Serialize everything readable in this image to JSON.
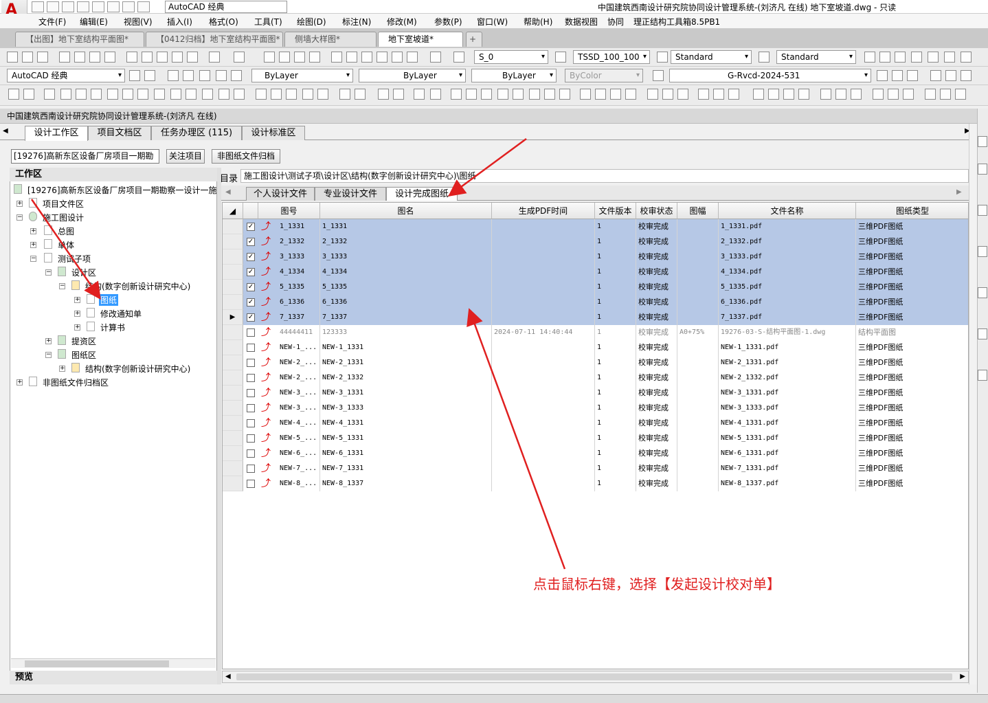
{
  "window": {
    "workspace": "AutoCAD 经典",
    "title": "中国建筑西南设计研究院协同设计管理系统-(刘济凡 在线)    地下室坡道.dwg - 只读"
  },
  "menu": [
    "文件(F)",
    "编辑(E)",
    "视图(V)",
    "插入(I)",
    "格式(O)",
    "工具(T)",
    "绘图(D)",
    "标注(N)",
    "修改(M)",
    "参数(P)",
    "窗口(W)",
    "帮助(H)",
    "数据视图",
    "协同",
    "理正结构工具箱8.5PB1"
  ],
  "doc_tabs": [
    {
      "label": "【出图】地下室结构平面图*",
      "active": false
    },
    {
      "label": "【0412归档】地下室结构平面图*",
      "active": false
    },
    {
      "label": "侧墙大样图*",
      "active": false
    },
    {
      "label": "地下室坡道*",
      "active": true
    }
  ],
  "toolbar": {
    "textstyle": "S_0",
    "dimstyle": "TSSD_100_100",
    "tablestyle": "Standard",
    "mlstyle": "Standard",
    "workspace2": "AutoCAD 经典",
    "color": "ByLayer",
    "linetype": "ByLayer",
    "lineweight": "ByLayer",
    "plotstyle": "ByColor",
    "layer": "G-Rvcd-2024-531"
  },
  "panel": {
    "title": "中国建筑西南设计研究院协同设计管理系统-(刘济凡 在线)",
    "tabs": [
      {
        "label": "设计工作区",
        "active": true
      },
      {
        "label": "项目文档区",
        "active": false
      },
      {
        "label": "任务办理区 (115)",
        "active": false
      },
      {
        "label": "设计标准区",
        "active": false
      }
    ],
    "project_select": "[19276]高新东区设备厂房项目一期勘",
    "follow_btn": "关注项目",
    "nonfile_btn": "非图纸文件归档"
  },
  "tree": {
    "header": "工作区",
    "preview": "预览",
    "root": "[19276]高新东区设备厂房项目一期勘察一设计一施",
    "items": {
      "proj_files": "项目文件区",
      "construction": "施工图设计",
      "general": "总图",
      "single": "单体",
      "test": "测试子项",
      "design": "设计区",
      "structure": "结构(数字创新设计研究中心)",
      "drawings": "图纸",
      "notice": "修改通知单",
      "calc": "计算书",
      "submit": "提资区",
      "drawzone": "图纸区",
      "structure2": "结构(数字创新设计研究中心)",
      "nonfile": "非图纸文件归档区"
    }
  },
  "content": {
    "dir_label": "目录",
    "dir_path": "施工图设计\\测试子项\\设计区\\结构(数字创新设计研究中心)\\图纸",
    "subtabs": [
      {
        "label": "个人设计文件",
        "active": false
      },
      {
        "label": "专业设计文件",
        "active": false
      },
      {
        "label": "设计完成图纸",
        "active": true
      }
    ],
    "columns": [
      "图号",
      "图名",
      "生成PDF时间",
      "文件版本",
      "校审状态",
      "图幅",
      "文件名称",
      "图纸类型"
    ],
    "rows": [
      {
        "no": "1_1331",
        "name": "1_1331",
        "time": "",
        "ver": "1",
        "status": "校审完成",
        "size": "",
        "file": "1_1331.pdf",
        "type": "三维PDF图纸",
        "checked": true,
        "selected": true
      },
      {
        "no": "2_1332",
        "name": "2_1332",
        "time": "",
        "ver": "1",
        "status": "校审完成",
        "size": "",
        "file": "2_1332.pdf",
        "type": "三维PDF图纸",
        "checked": true,
        "selected": true
      },
      {
        "no": "3_1333",
        "name": "3_1333",
        "time": "",
        "ver": "1",
        "status": "校审完成",
        "size": "",
        "file": "3_1333.pdf",
        "type": "三维PDF图纸",
        "checked": true,
        "selected": true
      },
      {
        "no": "4_1334",
        "name": "4_1334",
        "time": "",
        "ver": "1",
        "status": "校审完成",
        "size": "",
        "file": "4_1334.pdf",
        "type": "三维PDF图纸",
        "checked": true,
        "selected": true
      },
      {
        "no": "5_1335",
        "name": "5_1335",
        "time": "",
        "ver": "1",
        "status": "校审完成",
        "size": "",
        "file": "5_1335.pdf",
        "type": "三维PDF图纸",
        "checked": true,
        "selected": true
      },
      {
        "no": "6_1336",
        "name": "6_1336",
        "time": "",
        "ver": "1",
        "status": "校审完成",
        "size": "",
        "file": "6_1336.pdf",
        "type": "三维PDF图纸",
        "checked": true,
        "selected": true
      },
      {
        "no": "7_1337",
        "name": "7_1337",
        "time": "",
        "ver": "1",
        "status": "校审完成",
        "size": "",
        "file": "7_1337.pdf",
        "type": "三维PDF图纸",
        "checked": true,
        "selected": true,
        "current": true
      },
      {
        "no": "44444411",
        "name": "123333",
        "time": "2024-07-11 14:40:44",
        "ver": "1",
        "status": "校审完成",
        "size": "A0+75%",
        "file": "19276-03-S-结构平面图-1.dwg",
        "type": "结构平面图",
        "checked": false,
        "selected": false,
        "gray": true
      },
      {
        "no": "NEW-1_...",
        "name": "NEW-1_1331",
        "time": "",
        "ver": "1",
        "status": "校审完成",
        "size": "",
        "file": "NEW-1_1331.pdf",
        "type": "三维PDF图纸",
        "checked": false,
        "selected": false
      },
      {
        "no": "NEW-2_...",
        "name": "NEW-2_1331",
        "time": "",
        "ver": "1",
        "status": "校审完成",
        "size": "",
        "file": "NEW-2_1331.pdf",
        "type": "三维PDF图纸",
        "checked": false,
        "selected": false
      },
      {
        "no": "NEW-2_...",
        "name": "NEW-2_1332",
        "time": "",
        "ver": "1",
        "status": "校审完成",
        "size": "",
        "file": "NEW-2_1332.pdf",
        "type": "三维PDF图纸",
        "checked": false,
        "selected": false
      },
      {
        "no": "NEW-3_...",
        "name": "NEW-3_1331",
        "time": "",
        "ver": "1",
        "status": "校审完成",
        "size": "",
        "file": "NEW-3_1331.pdf",
        "type": "三维PDF图纸",
        "checked": false,
        "selected": false
      },
      {
        "no": "NEW-3_...",
        "name": "NEW-3_1333",
        "time": "",
        "ver": "1",
        "status": "校审完成",
        "size": "",
        "file": "NEW-3_1333.pdf",
        "type": "三维PDF图纸",
        "checked": false,
        "selected": false
      },
      {
        "no": "NEW-4_...",
        "name": "NEW-4_1331",
        "time": "",
        "ver": "1",
        "status": "校审完成",
        "size": "",
        "file": "NEW-4_1331.pdf",
        "type": "三维PDF图纸",
        "checked": false,
        "selected": false
      },
      {
        "no": "NEW-5_...",
        "name": "NEW-5_1331",
        "time": "",
        "ver": "1",
        "status": "校审完成",
        "size": "",
        "file": "NEW-5_1331.pdf",
        "type": "三维PDF图纸",
        "checked": false,
        "selected": false
      },
      {
        "no": "NEW-6_...",
        "name": "NEW-6_1331",
        "time": "",
        "ver": "1",
        "status": "校审完成",
        "size": "",
        "file": "NEW-6_1331.pdf",
        "type": "三维PDF图纸",
        "checked": false,
        "selected": false
      },
      {
        "no": "NEW-7_...",
        "name": "NEW-7_1331",
        "time": "",
        "ver": "1",
        "status": "校审完成",
        "size": "",
        "file": "NEW-7_1331.pdf",
        "type": "三维PDF图纸",
        "checked": false,
        "selected": false
      },
      {
        "no": "NEW-8_...",
        "name": "NEW-8_1337",
        "time": "",
        "ver": "1",
        "status": "校审完成",
        "size": "",
        "file": "NEW-8_1337.pdf",
        "type": "三维PDF图纸",
        "checked": false,
        "selected": false
      }
    ]
  },
  "annotation": "点击鼠标右键，选择【发起设计校对单】",
  "colors": {
    "annotation": "#e02020",
    "selection": "#b6c8e6",
    "tree_select": "#3399ff"
  }
}
